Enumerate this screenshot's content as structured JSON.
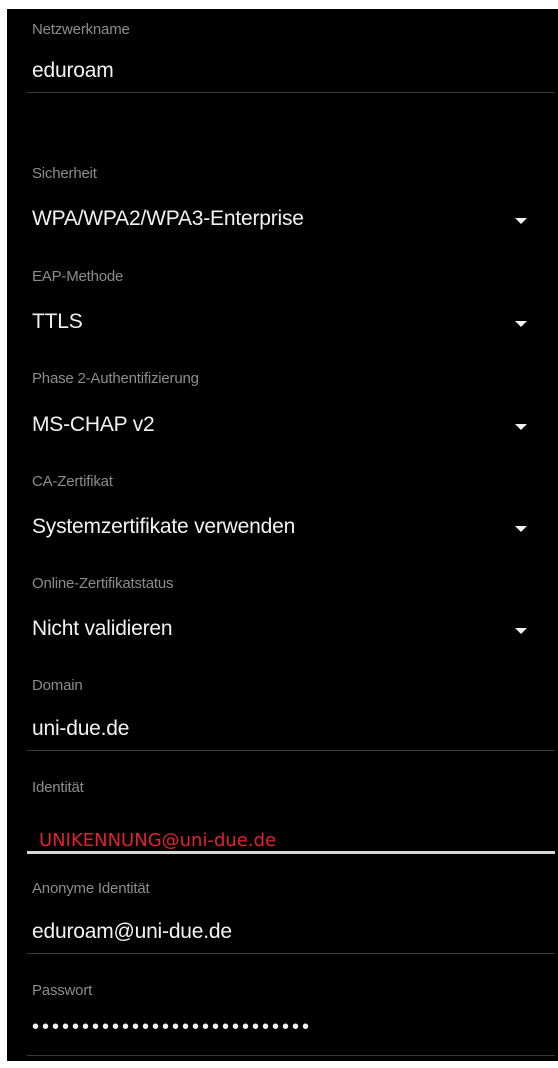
{
  "network": {
    "label": "Netzwerkname",
    "value": "eduroam"
  },
  "security": {
    "label": "Sicherheit",
    "value": "WPA/WPA2/WPA3-Enterprise"
  },
  "eap": {
    "label": "EAP-Methode",
    "value": "TTLS"
  },
  "phase2": {
    "label": "Phase 2-Authentifizierung",
    "value": "MS-CHAP v2"
  },
  "ca_cert": {
    "label": "CA-Zertifikat",
    "value": "Systemzertifikate verwenden"
  },
  "online_cert": {
    "label": "Online-Zertifikatstatus",
    "value": "Nicht validieren"
  },
  "domain": {
    "label": "Domain",
    "value": "uni-due.de"
  },
  "identity": {
    "label": "Identität",
    "value": "UNIKENNUNG@uni-due.de"
  },
  "anon_identity": {
    "label": "Anonyme Identität",
    "value": "eduroam@uni-due.de"
  },
  "password": {
    "label": "Passwort",
    "value": "••••••••••••••••••••••••••••"
  },
  "colors": {
    "background": "#000000",
    "label": "#8c8c8c",
    "value": "#f2f2f2",
    "highlight": "#e0242c",
    "active_underline": "#d8d8d8"
  },
  "icons": {
    "dropdown": "caret-down-icon"
  }
}
